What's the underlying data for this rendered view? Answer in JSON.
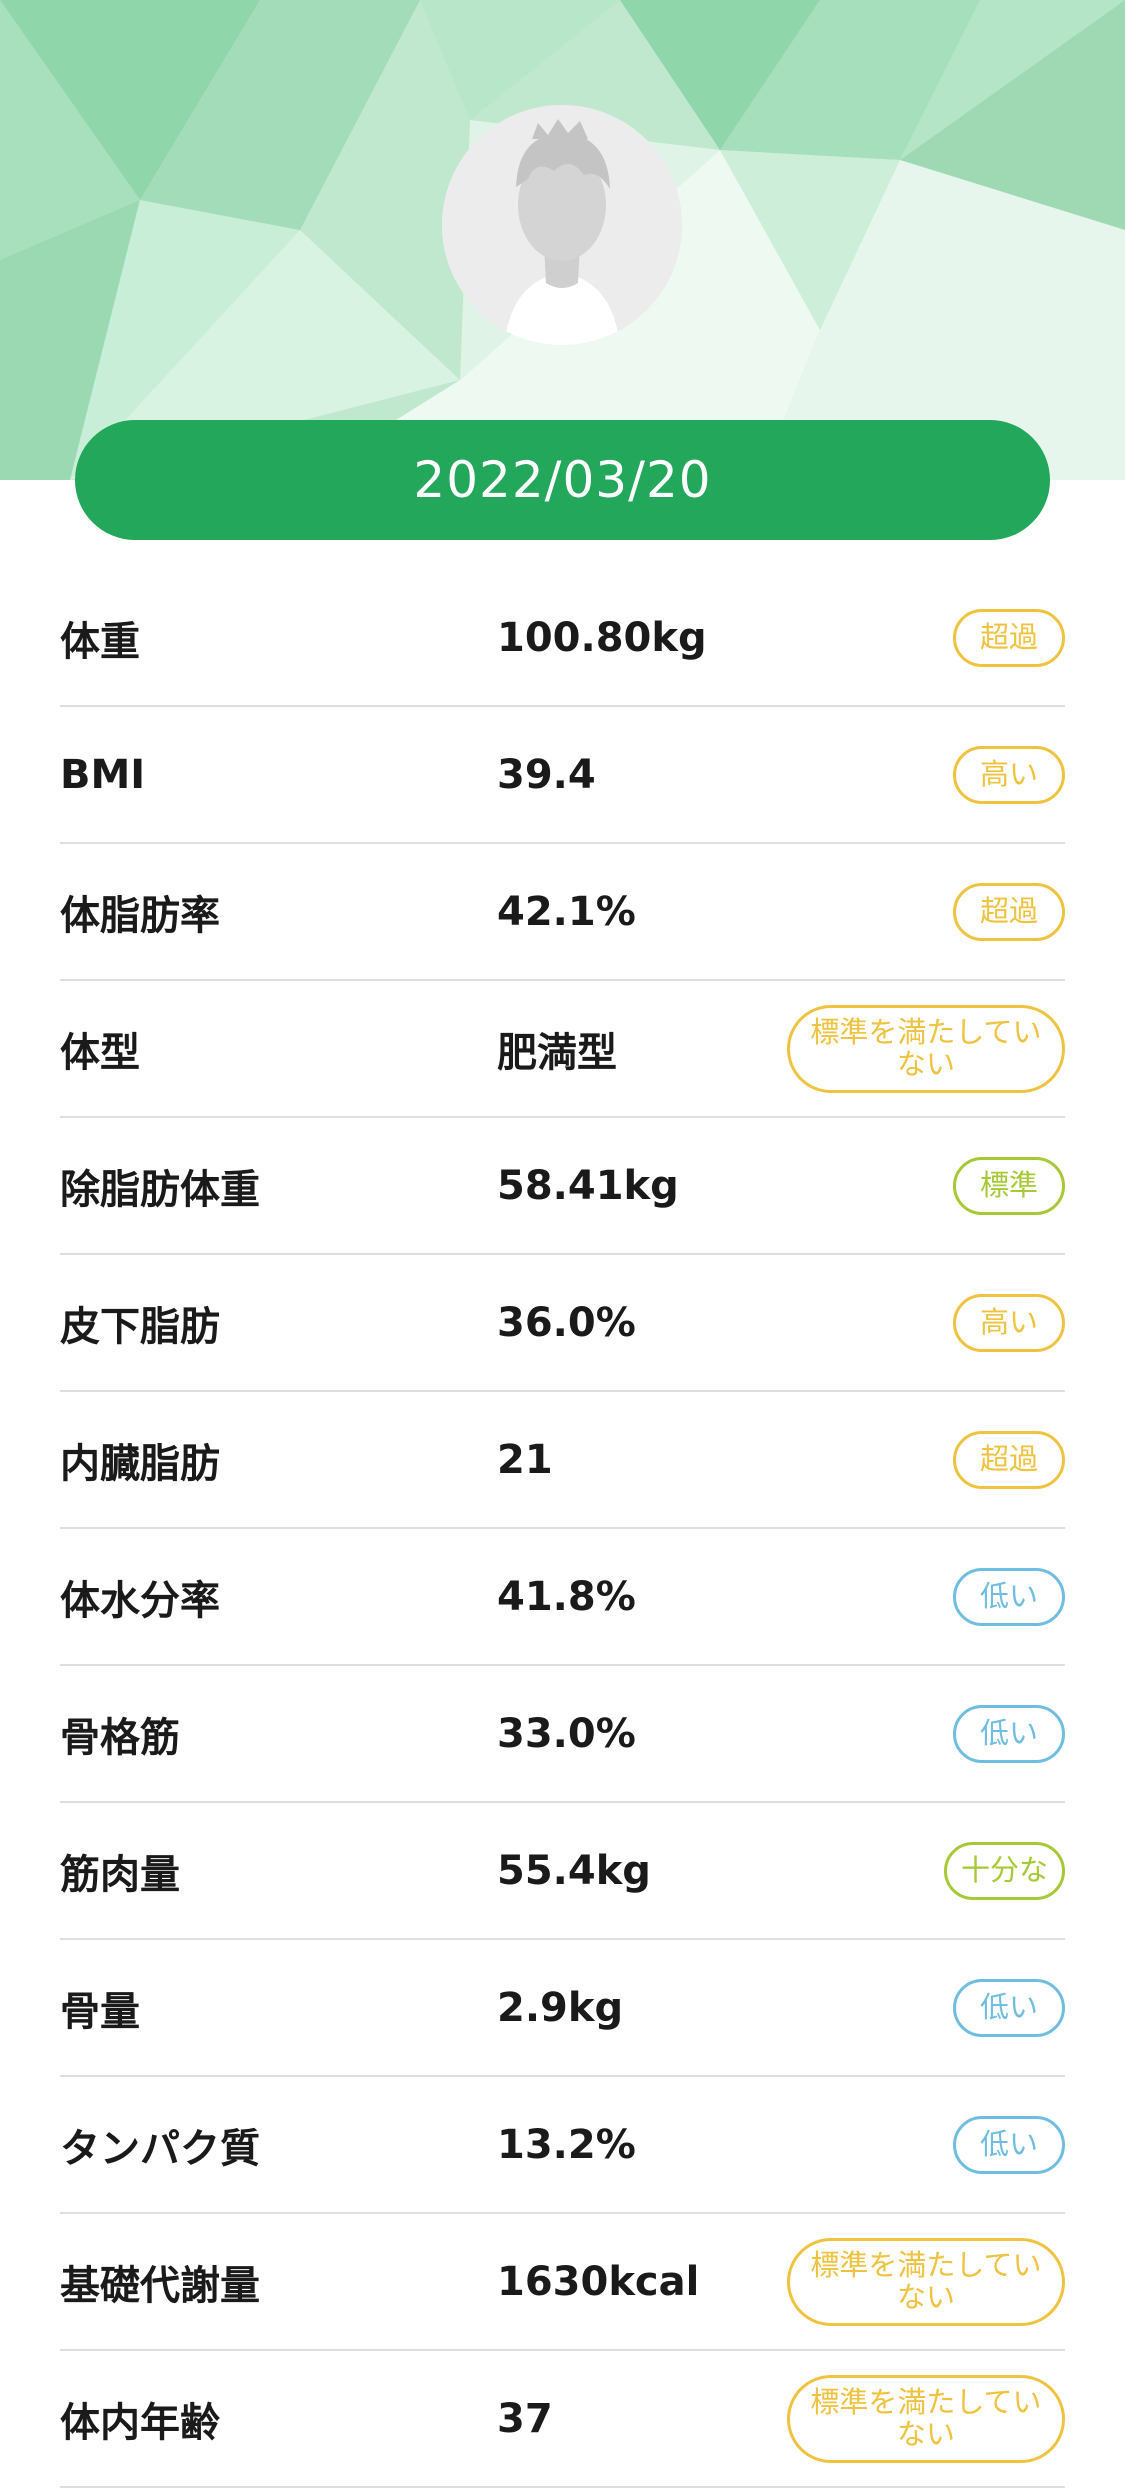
{
  "header": {
    "date": "2022/03/20",
    "colors": {
      "brand_green": "#23a75a",
      "warn": "#efc23f",
      "good": "#a6c936",
      "low": "#6fbde0"
    }
  },
  "metrics": [
    {
      "label": "体重",
      "value": "100.80kg",
      "status": "超過",
      "tone": "warn"
    },
    {
      "label": "BMI",
      "value": "39.4",
      "status": "高い",
      "tone": "warn"
    },
    {
      "label": "体脂肪率",
      "value": "42.1%",
      "status": "超過",
      "tone": "warn"
    },
    {
      "label": "体型",
      "value": "肥満型",
      "status": "標準を満たしていない",
      "tone": "warn"
    },
    {
      "label": "除脂肪体重",
      "value": "58.41kg",
      "status": "標準",
      "tone": "good"
    },
    {
      "label": "皮下脂肪",
      "value": "36.0%",
      "status": "高い",
      "tone": "warn"
    },
    {
      "label": "内臓脂肪",
      "value": "21",
      "status": "超過",
      "tone": "warn"
    },
    {
      "label": "体水分率",
      "value": "41.8%",
      "status": "低い",
      "tone": "low"
    },
    {
      "label": "骨格筋",
      "value": "33.0%",
      "status": "低い",
      "tone": "low"
    },
    {
      "label": "筋肉量",
      "value": "55.4kg",
      "status": "十分な",
      "tone": "good"
    },
    {
      "label": "骨量",
      "value": "2.9kg",
      "status": "低い",
      "tone": "low"
    },
    {
      "label": "タンパク質",
      "value": "13.2%",
      "status": "低い",
      "tone": "low"
    },
    {
      "label": "基礎代謝量",
      "value": "1630kcal",
      "status": "標準を満たしていない",
      "tone": "warn"
    },
    {
      "label": "体内年齢",
      "value": "37",
      "status": "標準を満たしていない",
      "tone": "warn"
    }
  ]
}
